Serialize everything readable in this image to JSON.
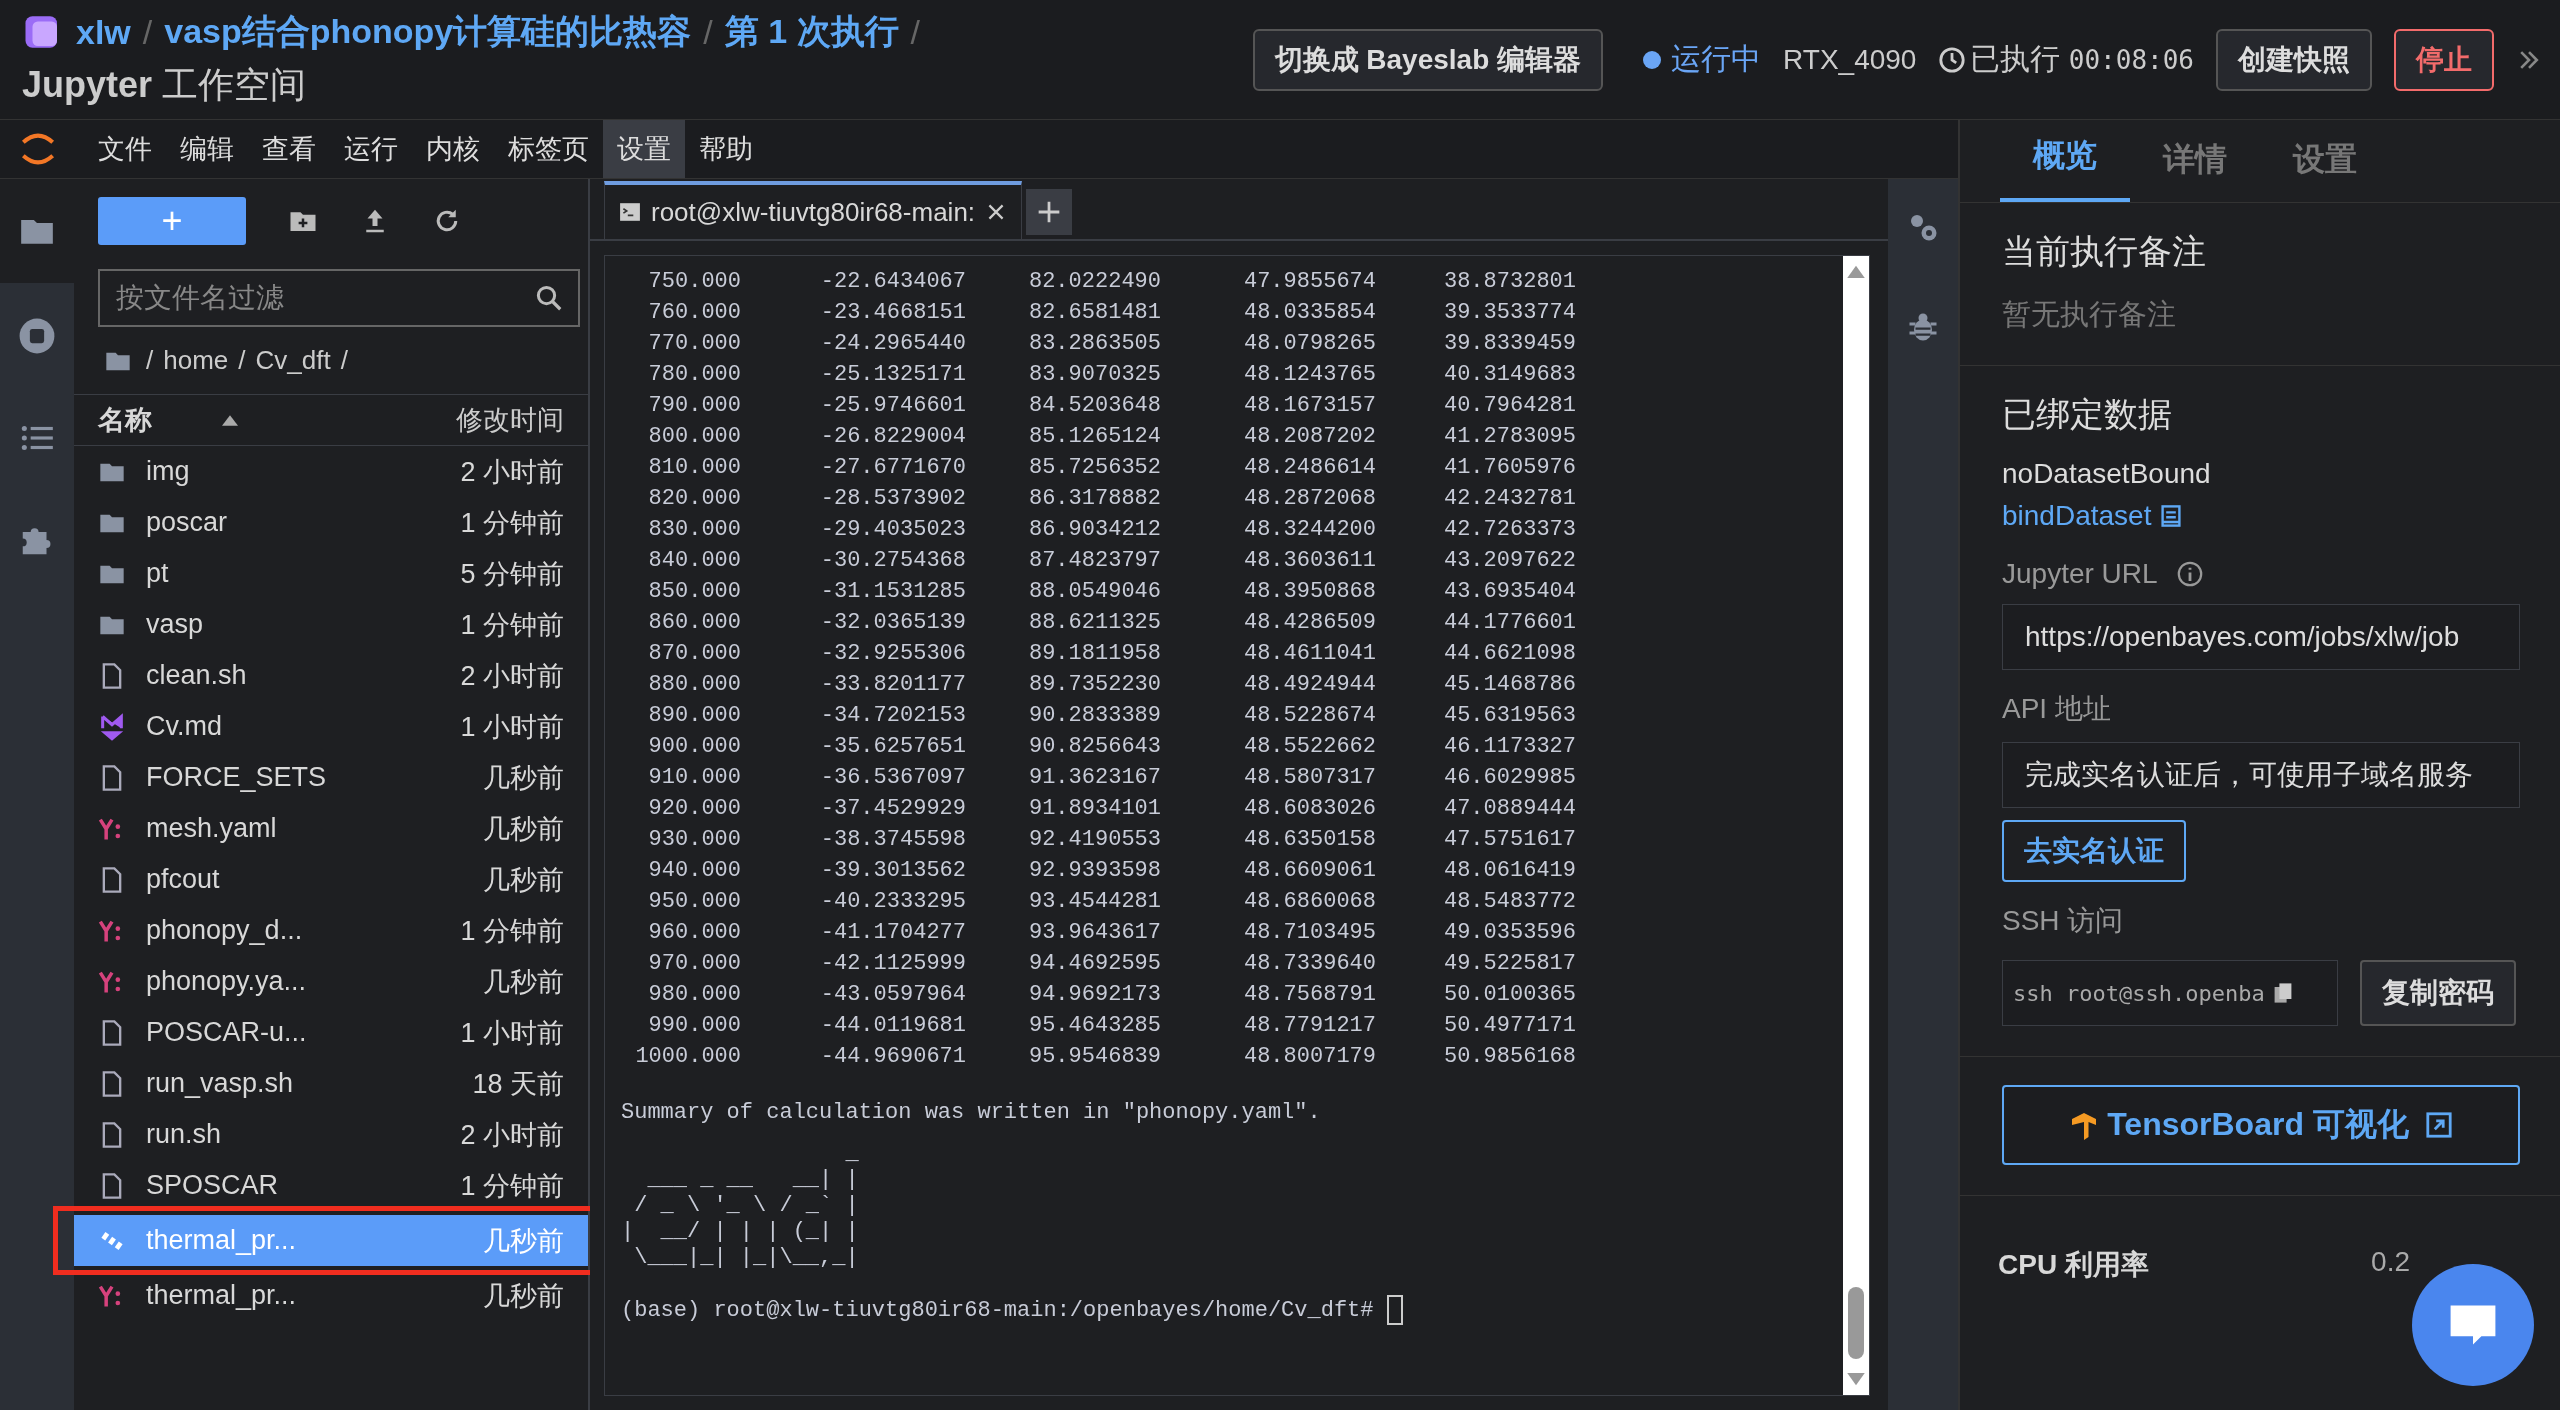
{
  "header": {
    "breadcrumb": [
      "xlw",
      "vasp结合phonopy计算硅的比热容",
      "第 1 次执行"
    ],
    "separator": "/",
    "subtitle_strong": "Jupyter",
    "subtitle": "工作空间",
    "switch_button": "切换成 Bayeslab 编辑器",
    "status": "运行中",
    "gpu": "RTX_4090",
    "elapsed_label": "已执行",
    "elapsed": "00:08:06",
    "snapshot_button": "创建快照",
    "stop_button": "停止"
  },
  "menu": [
    {
      "label": "文件",
      "selected": false
    },
    {
      "label": "编辑",
      "selected": false
    },
    {
      "label": "查看",
      "selected": false
    },
    {
      "label": "运行",
      "selected": false
    },
    {
      "label": "内核",
      "selected": false
    },
    {
      "label": "标签页",
      "selected": false
    },
    {
      "label": "设置",
      "selected": true
    },
    {
      "label": "帮助",
      "selected": false
    }
  ],
  "file_browser": {
    "new_button": "+",
    "filter_placeholder": "按文件名过滤",
    "path": [
      "/",
      "home",
      "/",
      "Cv_dft",
      "/"
    ],
    "columns": [
      "名称",
      "修改时间"
    ],
    "files": [
      {
        "kind": "folder",
        "name": "img",
        "modified": "2 小时前",
        "selected": false,
        "annotated": false
      },
      {
        "kind": "folder",
        "name": "poscar",
        "modified": "1 分钟前",
        "selected": false,
        "annotated": false
      },
      {
        "kind": "folder",
        "name": "pt",
        "modified": "5 分钟前",
        "selected": false,
        "annotated": false
      },
      {
        "kind": "folder",
        "name": "vasp",
        "modified": "1 分钟前",
        "selected": false,
        "annotated": false
      },
      {
        "kind": "file",
        "name": "clean.sh",
        "modified": "2 小时前",
        "selected": false,
        "annotated": false
      },
      {
        "kind": "markdown",
        "name": "Cv.md",
        "modified": "1 小时前",
        "selected": false,
        "annotated": false
      },
      {
        "kind": "file",
        "name": "FORCE_SETS",
        "modified": "几秒前",
        "selected": false,
        "annotated": false
      },
      {
        "kind": "yaml",
        "name": "mesh.yaml",
        "modified": "几秒前",
        "selected": false,
        "annotated": false
      },
      {
        "kind": "file",
        "name": "pfcout",
        "modified": "几秒前",
        "selected": false,
        "annotated": false
      },
      {
        "kind": "yaml",
        "name": "phonopy_d...",
        "modified": "1 分钟前",
        "selected": false,
        "annotated": false
      },
      {
        "kind": "yaml",
        "name": "phonopy.ya...",
        "modified": "几秒前",
        "selected": false,
        "annotated": false
      },
      {
        "kind": "file",
        "name": "POSCAR-u...",
        "modified": "1 小时前",
        "selected": false,
        "annotated": false
      },
      {
        "kind": "file",
        "name": "run_vasp.sh",
        "modified": "18 天前",
        "selected": false,
        "annotated": false
      },
      {
        "kind": "file",
        "name": "run.sh",
        "modified": "2 小时前",
        "selected": false,
        "annotated": false
      },
      {
        "kind": "file",
        "name": "SPOSCAR",
        "modified": "1 分钟前",
        "selected": false,
        "annotated": false
      },
      {
        "kind": "pdf",
        "name": "thermal_pr...",
        "modified": "几秒前",
        "selected": true,
        "annotated": true
      },
      {
        "kind": "yaml",
        "name": "thermal_pr...",
        "modified": "几秒前",
        "selected": false,
        "annotated": false
      }
    ]
  },
  "terminal": {
    "tab": "root@xlw-tiuvtg80ir68-main:",
    "rows": [
      [
        "750.000",
        "-22.6434067",
        "82.0222490",
        "47.9855674",
        "38.8732801"
      ],
      [
        "760.000",
        "-23.4668151",
        "82.6581481",
        "48.0335854",
        "39.3533774"
      ],
      [
        "770.000",
        "-24.2965440",
        "83.2863505",
        "48.0798265",
        "39.8339459"
      ],
      [
        "780.000",
        "-25.1325171",
        "83.9070325",
        "48.1243765",
        "40.3149683"
      ],
      [
        "790.000",
        "-25.9746601",
        "84.5203648",
        "48.1673157",
        "40.7964281"
      ],
      [
        "800.000",
        "-26.8229004",
        "85.1265124",
        "48.2087202",
        "41.2783095"
      ],
      [
        "810.000",
        "-27.6771670",
        "85.7256352",
        "48.2486614",
        "41.7605976"
      ],
      [
        "820.000",
        "-28.5373902",
        "86.3178882",
        "48.2872068",
        "42.2432781"
      ],
      [
        "830.000",
        "-29.4035023",
        "86.9034212",
        "48.3244200",
        "42.7263373"
      ],
      [
        "840.000",
        "-30.2754368",
        "87.4823797",
        "48.3603611",
        "43.2097622"
      ],
      [
        "850.000",
        "-31.1531285",
        "88.0549046",
        "48.3950868",
        "43.6935404"
      ],
      [
        "860.000",
        "-32.0365139",
        "88.6211325",
        "48.4286509",
        "44.1776601"
      ],
      [
        "870.000",
        "-32.9255306",
        "89.1811958",
        "48.4611041",
        "44.6621098"
      ],
      [
        "880.000",
        "-33.8201177",
        "89.7352230",
        "48.4924944",
        "45.1468786"
      ],
      [
        "890.000",
        "-34.7202153",
        "90.2833389",
        "48.5228674",
        "45.6319563"
      ],
      [
        "900.000",
        "-35.6257651",
        "90.8256643",
        "48.5522662",
        "46.1173327"
      ],
      [
        "910.000",
        "-36.5367097",
        "91.3623167",
        "48.5807317",
        "46.6029985"
      ],
      [
        "920.000",
        "-37.4529929",
        "91.8934101",
        "48.6083026",
        "47.0889444"
      ],
      [
        "930.000",
        "-38.3745598",
        "92.4190553",
        "48.6350158",
        "47.5751617"
      ],
      [
        "940.000",
        "-39.3013562",
        "92.9393598",
        "48.6609061",
        "48.0616419"
      ],
      [
        "950.000",
        "-40.2333295",
        "93.4544281",
        "48.6860068",
        "48.5483772"
      ],
      [
        "960.000",
        "-41.1704277",
        "93.9643617",
        "48.7103495",
        "49.0353596"
      ],
      [
        "970.000",
        "-42.1125999",
        "94.4692595",
        "48.7339640",
        "49.5225817"
      ],
      [
        "980.000",
        "-43.0597964",
        "94.9692173",
        "48.7568791",
        "50.0100365"
      ],
      [
        "990.000",
        "-44.0119681",
        "95.4643285",
        "48.7791217",
        "50.4977171"
      ],
      [
        "1000.000",
        "-44.9690671",
        "95.9546839",
        "48.8007179",
        "50.9856168"
      ]
    ],
    "summary": "Summary of calculation was written in \"phonopy.yaml\".",
    "ascii_art": "                 _ \n  ___ _ __   __| |\n / _ \\ '_ \\ / _` |\n|  __/ | | | (_| |\n \\___|_| |_|\\__,_|",
    "prompt": "(base) root@xlw-tiuvtg80ir68-main:/openbayes/home/Cv_dft# "
  },
  "panel": {
    "tabs": [
      {
        "label": "概览",
        "selected": true
      },
      {
        "label": "详情",
        "selected": false
      },
      {
        "label": "设置",
        "selected": false
      }
    ],
    "note_title": "当前执行备注",
    "note_empty": "暂无执行备注",
    "data_title": "已绑定数据",
    "data_none": "noDatasetBound",
    "bind_link": "bindDataset",
    "jupyter_label": "Jupyter URL",
    "jupyter_url": "https://openbayes.com/jobs/xlw/job",
    "api_label": "API 地址",
    "api_value": "完成实名认证后，可使用子域名服务",
    "verify_button": "去实名认证",
    "ssh_label": "SSH 访问",
    "ssh_value": "ssh root@ssh.openba",
    "copy_button": "复制密码",
    "tensorboard_button": "TensorBoard 可视化",
    "cpu_label": "CPU 利用率",
    "cpu_value": "0.2"
  }
}
